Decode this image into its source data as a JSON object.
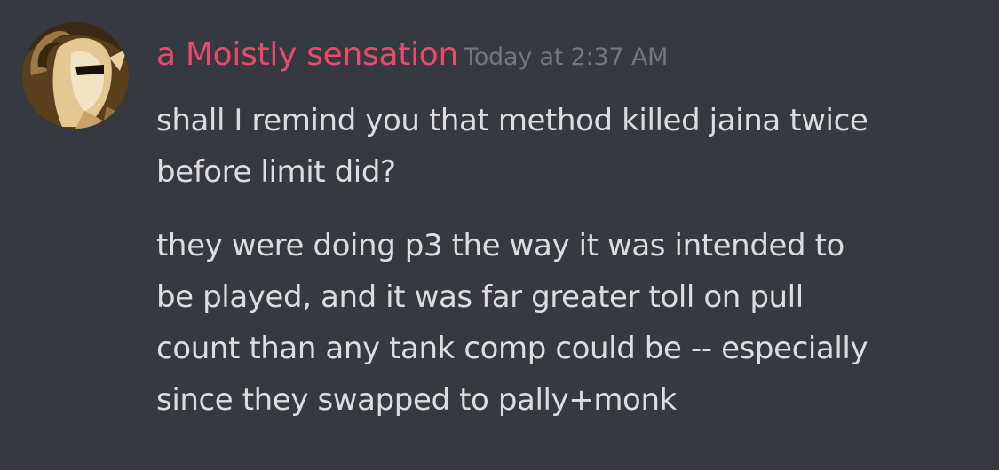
{
  "message": {
    "author": "a Moistly sensation",
    "timestamp": "Today at 2:37 AM",
    "paragraphs": [
      {
        "lines": [
          "shall I remind you that method killed jaina twice",
          "before limit did?"
        ]
      },
      {
        "lines": [
          "they were doing p3 the way it was intended to",
          "be played, and it was far greater toll on pull",
          "count than any tank comp could be -- especially",
          "since they swapped to pally+monk"
        ]
      }
    ]
  },
  "colors": {
    "background": "#36393f",
    "author": "#e64b6c",
    "timestamp": "#72767d",
    "text": "#dcddde"
  },
  "avatar": {
    "icon": "user-avatar-image"
  }
}
